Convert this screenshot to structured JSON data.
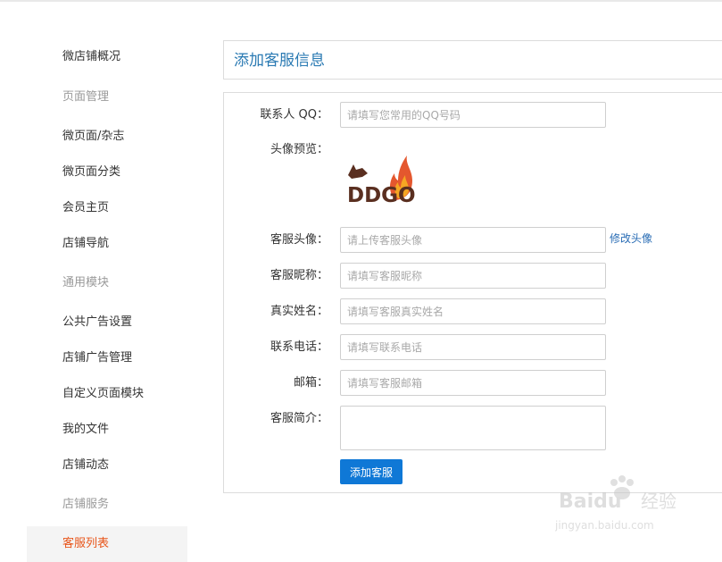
{
  "sidebar": {
    "items": [
      {
        "label": "微店铺概况",
        "type": "link"
      },
      {
        "label": "页面管理",
        "type": "group"
      },
      {
        "label": "微页面/杂志",
        "type": "link"
      },
      {
        "label": "微页面分类",
        "type": "link"
      },
      {
        "label": "会员主页",
        "type": "link"
      },
      {
        "label": "店铺导航",
        "type": "link"
      },
      {
        "label": "通用模块",
        "type": "group"
      },
      {
        "label": "公共广告设置",
        "type": "link"
      },
      {
        "label": "店铺广告管理",
        "type": "link"
      },
      {
        "label": "自定义页面模块",
        "type": "link"
      },
      {
        "label": "我的文件",
        "type": "link"
      },
      {
        "label": "店铺动态",
        "type": "link"
      },
      {
        "label": "店铺服务",
        "type": "group"
      },
      {
        "label": "客服列表",
        "type": "active"
      }
    ]
  },
  "main": {
    "title": "添加客服信息"
  },
  "form": {
    "qq_label": "联系人 QQ：",
    "qq_placeholder": "请填写您常用的QQ号码",
    "avatar_preview_label": "头像预览：",
    "avatar_logo_text": "DDGO",
    "avatar_label": "客服头像：",
    "avatar_placeholder": "请上传客服头像",
    "edit_avatar_link": "修改头像",
    "nickname_label": "客服昵称：",
    "nickname_placeholder": "请填写客服昵称",
    "realname_label": "真实姓名：",
    "realname_placeholder": "请填写客服真实姓名",
    "phone_label": "联系电话：",
    "phone_placeholder": "请填写联系电话",
    "email_label": "邮箱：",
    "email_placeholder": "请填写客服邮箱",
    "intro_label": "客服简介：",
    "submit_label": "添加客服"
  },
  "watermark": {
    "brand": "Baidu",
    "brand_suffix": "经验",
    "url": "jingyan.baidu.com"
  },
  "colors": {
    "accent_blue": "#0f78d6",
    "title_blue": "#2a7ab3",
    "active_orange": "#e8551a",
    "group_gray": "#9a9a9a"
  }
}
